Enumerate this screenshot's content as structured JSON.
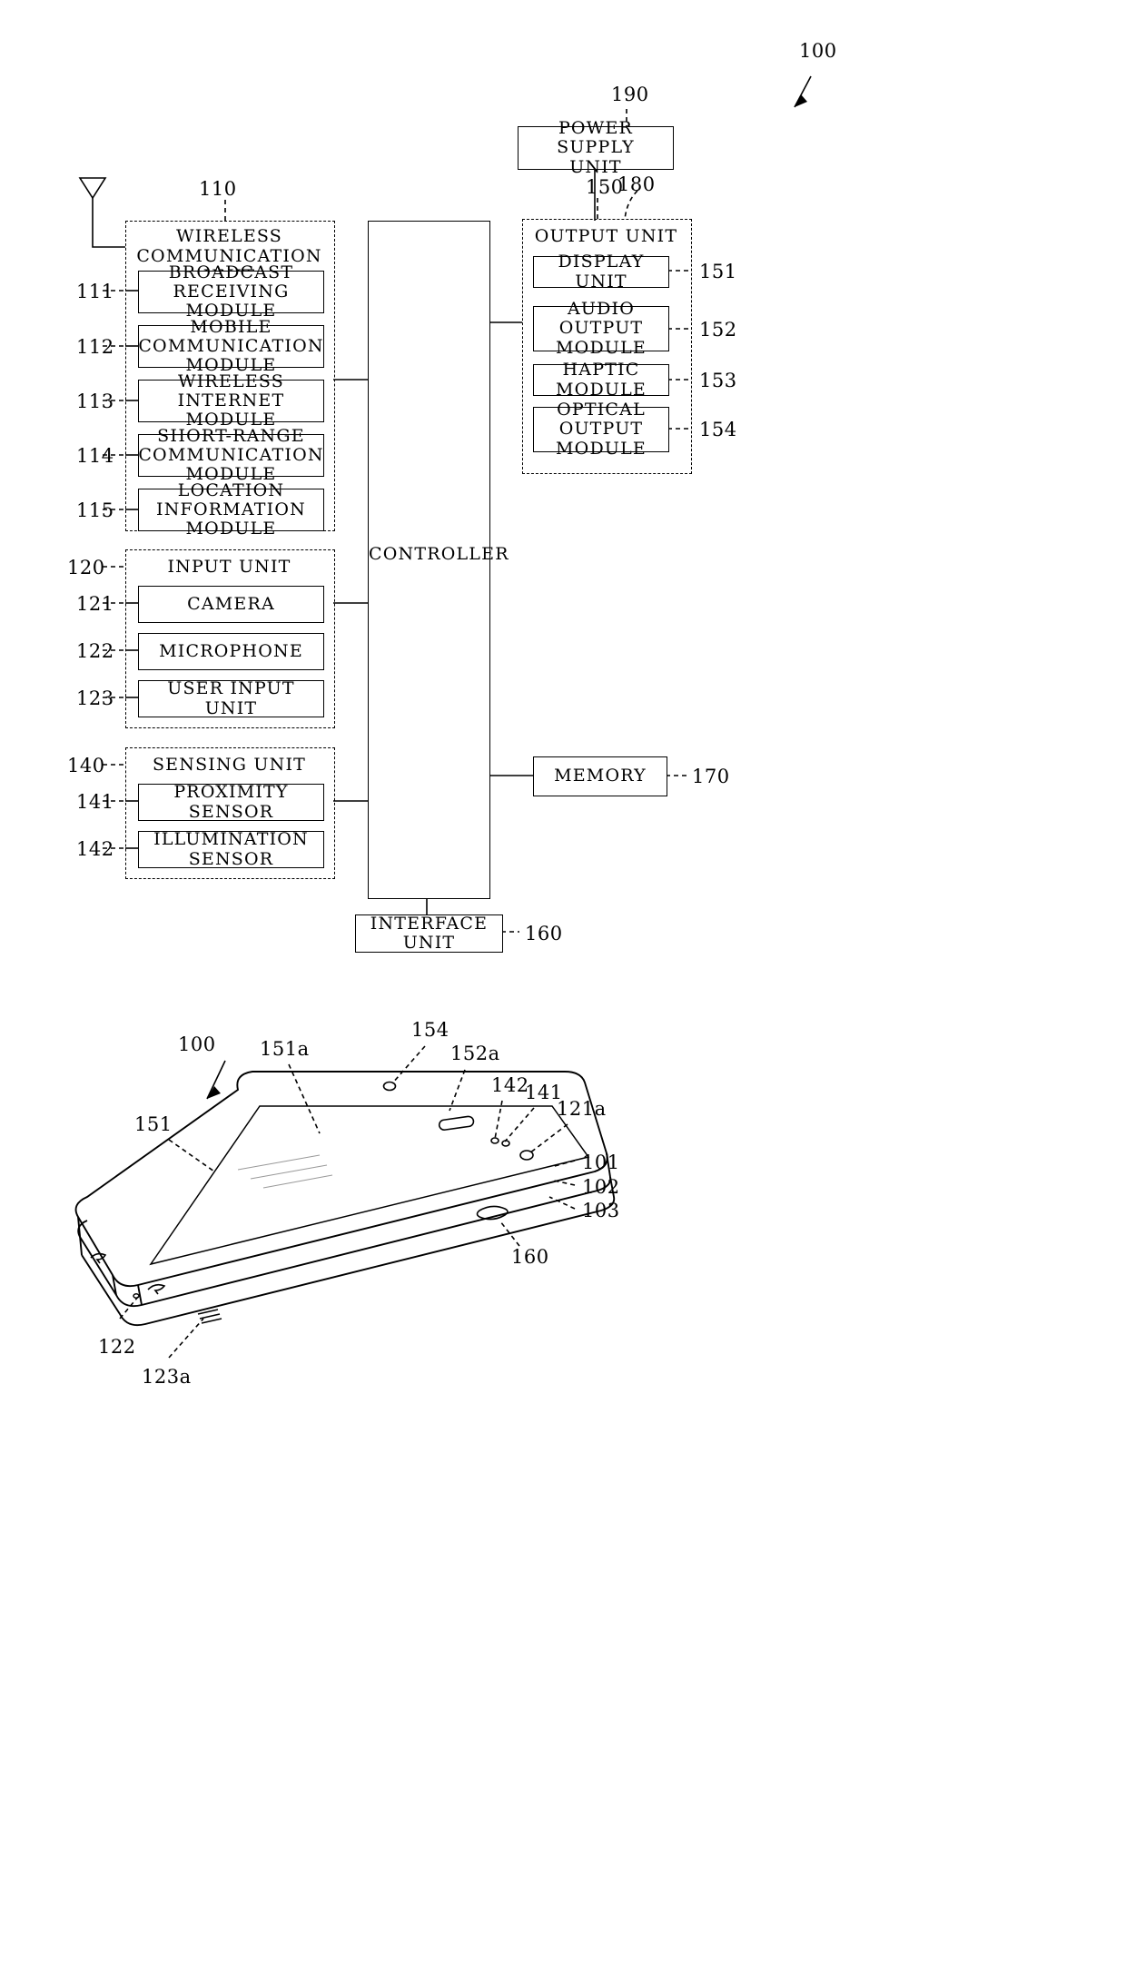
{
  "figure": {
    "top_ref": "100",
    "bottom_ref": "100"
  },
  "block_diagram": {
    "power_supply": {
      "label": "POWER SUPPLY\nUNIT",
      "ref": "190"
    },
    "controller": {
      "label": "CONTROLLER",
      "ref": "180"
    },
    "memory": {
      "label": "MEMORY",
      "ref": "170"
    },
    "interface": {
      "label": "INTERFACE UNIT",
      "ref": "160"
    },
    "wireless_unit": {
      "title": "WIRELESS\nCOMMUNICATION UNIT",
      "ref": "110",
      "modules": [
        {
          "label": "BROADCAST\nRECEIVING MODULE",
          "ref": "111"
        },
        {
          "label": "MOBILE\nCOMMUNICATION MODULE",
          "ref": "112"
        },
        {
          "label": "WIRELESS\nINTERNET MODULE",
          "ref": "113"
        },
        {
          "label": "SHORT-RANGE\nCOMMUNICATION MODULE",
          "ref": "114"
        },
        {
          "label": "LOCATION\nINFORMATION MODULE",
          "ref": "115"
        }
      ]
    },
    "input_unit": {
      "title": "INPUT UNIT",
      "ref": "120",
      "modules": [
        {
          "label": "CAMERA",
          "ref": "121"
        },
        {
          "label": "MICROPHONE",
          "ref": "122"
        },
        {
          "label": "USER INPUT UNIT",
          "ref": "123"
        }
      ]
    },
    "sensing_unit": {
      "title": "SENSING UNIT",
      "ref": "140",
      "modules": [
        {
          "label": "PROXIMITY SENSOR",
          "ref": "141"
        },
        {
          "label": "ILLUMINATION SENSOR",
          "ref": "142"
        }
      ]
    },
    "output_unit": {
      "title": "OUTPUT UNIT",
      "ref": "150",
      "modules": [
        {
          "label": "DISPLAY UNIT",
          "ref": "151"
        },
        {
          "label": "AUDIO OUTPUT\nMODULE",
          "ref": "152"
        },
        {
          "label": "HAPTIC MODULE",
          "ref": "153"
        },
        {
          "label": "OPTICAL OUTPUT\nMODULE",
          "ref": "154"
        }
      ]
    }
  },
  "device_figure": {
    "callouts": [
      {
        "ref": "100"
      },
      {
        "ref": "151"
      },
      {
        "ref": "151a"
      },
      {
        "ref": "154"
      },
      {
        "ref": "152a"
      },
      {
        "ref": "142"
      },
      {
        "ref": "141"
      },
      {
        "ref": "121a"
      },
      {
        "ref": "101"
      },
      {
        "ref": "102"
      },
      {
        "ref": "103"
      },
      {
        "ref": "160"
      },
      {
        "ref": "122"
      },
      {
        "ref": "123a"
      }
    ]
  },
  "colors": {
    "ink": "#000000",
    "paper": "#ffffff"
  }
}
